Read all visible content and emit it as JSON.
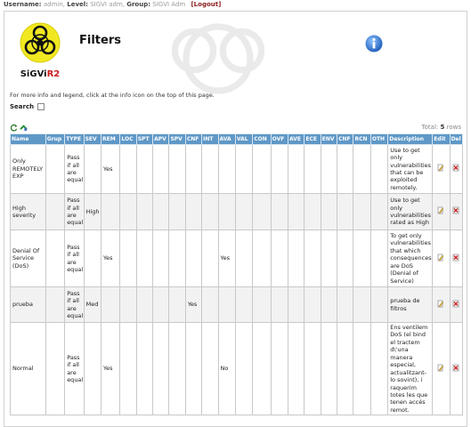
{
  "topbar": {
    "username_label": "Username:",
    "username": "admin,",
    "level_label": "Level:",
    "level": "SIGVI adm,",
    "group_label": "Group:",
    "group": "SIGVI Adm",
    "logout": "[Logout]"
  },
  "logo": {
    "text": "SiGViR2",
    "colors": {
      "yellow": "#f1e821",
      "red": "#cc1c1c",
      "black": "#111111"
    }
  },
  "page": {
    "title": "Filters"
  },
  "info_text": "For more info and legend, click at the info icon on the top of this page.",
  "search": {
    "label": "Search",
    "value": ""
  },
  "total": {
    "label": "Total:",
    "count": "5",
    "suffix": "rows"
  },
  "colors": {
    "header_bg": "#5f98c7",
    "alt_row": "#f2f2f2"
  },
  "table": {
    "columns": [
      "Name",
      "Grup",
      "TYPE",
      "SEV",
      "REM",
      "LOC",
      "SPT",
      "APV",
      "SPV",
      "CNF",
      "INT",
      "AVA",
      "VAL",
      "CON",
      "OVF",
      "AVE",
      "ECE",
      "ENV",
      "CNF",
      "RCN",
      "OTH",
      "Description",
      "Edit",
      "Del"
    ],
    "rows": [
      {
        "name": "Only REMOTELY EXP",
        "grup": "",
        "type": "Pass if all are equal",
        "sev": "",
        "rem": "Yes",
        "cnf": "",
        "ava": "",
        "description": "Use to get only vulnerabilities that can be exploited remotely."
      },
      {
        "name": "High severity",
        "grup": "",
        "type": "Pass if all are equal",
        "sev": "High",
        "rem": "",
        "cnf": "",
        "ava": "",
        "description": "Use to get only vulnerabilities rated as High"
      },
      {
        "name": "Denial Of Service (DoS)",
        "grup": "",
        "type": "Pass if all are equal",
        "sev": "",
        "rem": "Yes",
        "cnf": "",
        "ava": "Yes",
        "description": "To get only vulnerabilities that which consequences are DoS (Denial of Service)"
      },
      {
        "name": "prueba",
        "grup": "",
        "type": "Pass if all are equal",
        "sev": "Med",
        "rem": "",
        "cnf": "Yes",
        "ava": "",
        "description": "prueba de filtros"
      },
      {
        "name": "Normal",
        "grup": "",
        "type": "Pass if all are equal",
        "sev": "",
        "rem": "Yes",
        "cnf": "",
        "ava": "No",
        "description": "Ens ventilem DoS (el bind el tractem d\\'una manera especial, actualitzant-lo sovint), i raquerim totes les que tenen accés remot."
      }
    ]
  },
  "icons": {
    "info": "info-icon",
    "refresh": "refresh-icon",
    "add": "add-icon",
    "edit": "edit-icon",
    "delete": "delete-icon"
  }
}
